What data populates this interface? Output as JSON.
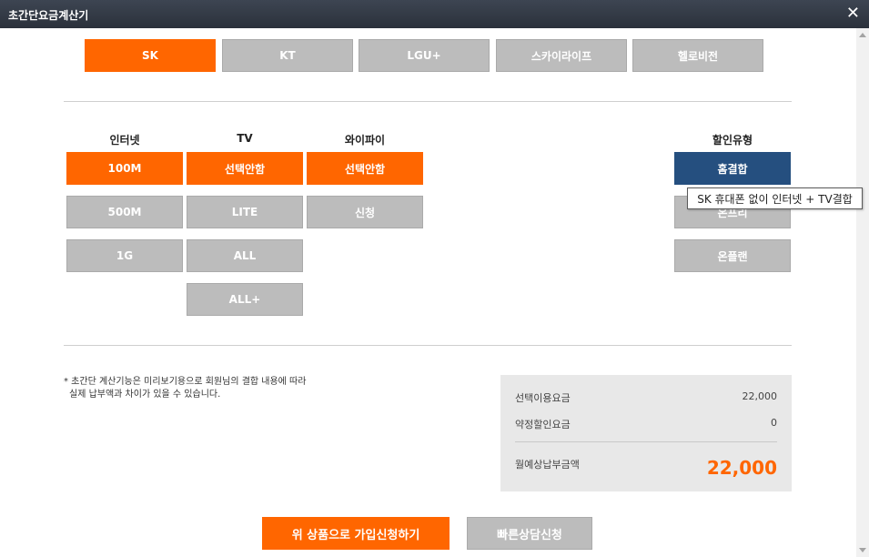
{
  "window": {
    "title": "초간단요금계산기"
  },
  "carriers": [
    "SK",
    "KT",
    "LGU+",
    "스카이라이프",
    "헬로비전"
  ],
  "columns": {
    "internet": {
      "label": "인터넷",
      "options": [
        "100M",
        "500M",
        "1G"
      ]
    },
    "tv": {
      "label": "TV",
      "options": [
        "선택안함",
        "LITE",
        "ALL",
        "ALL+"
      ]
    },
    "wifi": {
      "label": "와이파이",
      "options": [
        "선택안함",
        "신청"
      ]
    },
    "discount": {
      "label": "할인유형",
      "options": [
        "홈결합",
        "온프리",
        "온플랜"
      ]
    }
  },
  "tooltip": "SK 휴대폰 없이 인터넷 + TV결합",
  "note": {
    "line1": "* 초간단 계산기능은 미리보기용으로 회원님의 결합 내용에 따라",
    "line2": "실제 납부액과 차이가 있을 수 있습니다."
  },
  "summary": {
    "usage_label": "선택이용요금",
    "usage_value": "22,000",
    "discount_label": "약정할인요금",
    "discount_value": "0",
    "total_label": "월예상납부금액",
    "total_value": "22,000"
  },
  "actions": {
    "apply": "위 상품으로 가입신청하기",
    "consult": "빠른상담신청"
  },
  "colors": {
    "accent": "#ff6600",
    "selected_blue": "#254f7f",
    "unselected": "#bcbcbc"
  }
}
